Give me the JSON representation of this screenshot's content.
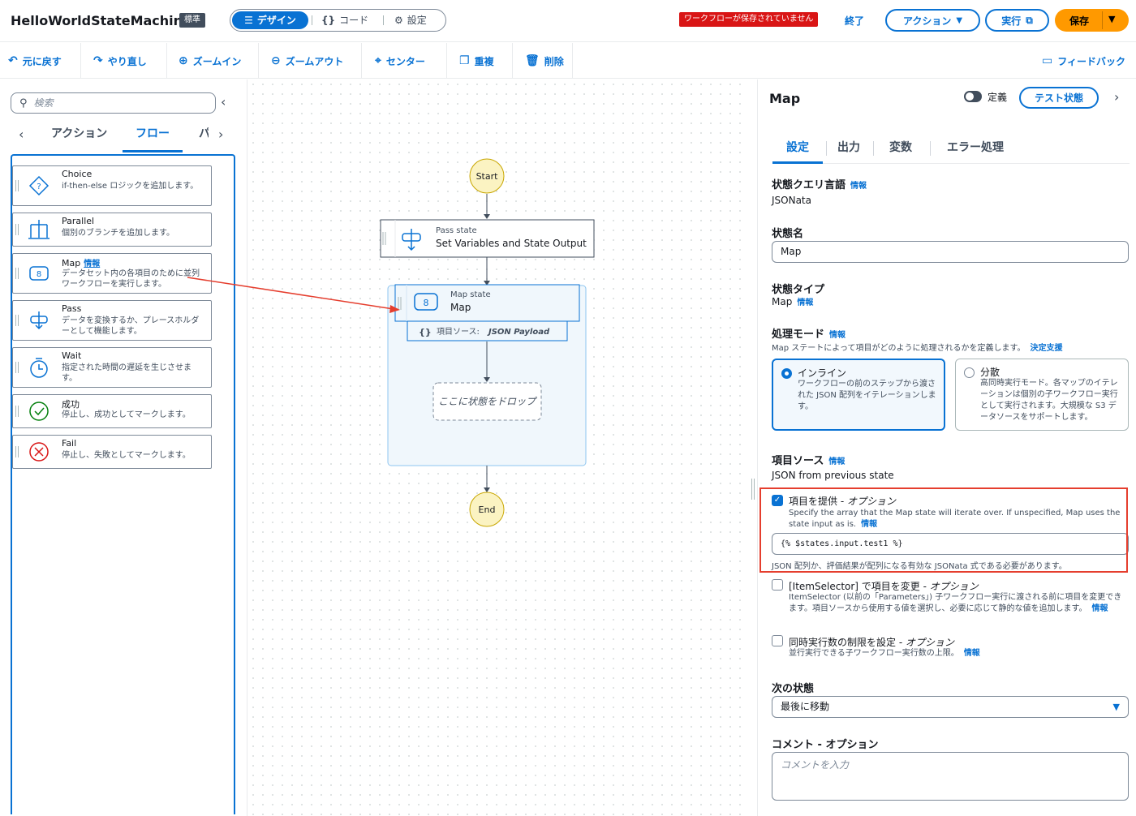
{
  "header": {
    "title": "HelloWorldStateMachine",
    "badge": "標準",
    "modes": {
      "design": "デザイン",
      "code": "コード",
      "settings": "設定"
    },
    "unsaved_notice": "ワークフローが保存されていません",
    "exit": "終了",
    "actions": "アクション",
    "run": "実行",
    "save": "保存"
  },
  "toolbar": {
    "undo": "元に戻す",
    "redo": "やり直し",
    "zoom_in": "ズームイン",
    "zoom_out": "ズームアウト",
    "center": "センター",
    "duplicate": "重複",
    "delete": "削除",
    "feedback": "フィードバック"
  },
  "left_panel": {
    "search_placeholder": "検索",
    "tabs": [
      "アクション",
      "フロー",
      "パ"
    ],
    "states": [
      {
        "name": "Choice",
        "desc": "if-then-else ロジックを追加します。",
        "icon": "choice-icon"
      },
      {
        "name": "Parallel",
        "desc": "個別のブランチを追加します。",
        "icon": "parallel-icon"
      },
      {
        "name": "Map",
        "info": "情報",
        "desc": "データセット内の各項目のために並列ワークフローを実行します。",
        "icon": "map-icon"
      },
      {
        "name": "Pass",
        "desc": "データを変換するか、プレースホルダーとして機能します。",
        "icon": "pass-icon"
      },
      {
        "name": "Wait",
        "desc": "指定された時間の遅延を生じさせます。",
        "icon": "wait-icon"
      },
      {
        "name": "成功",
        "desc": "停止し、成功としてマークします。",
        "icon": "success-icon"
      },
      {
        "name": "Fail",
        "desc": "停止し、失敗としてマークします。",
        "icon": "fail-icon"
      }
    ]
  },
  "canvas": {
    "start": "Start",
    "end": "End",
    "pass_type": "Pass state",
    "pass_name": "Set Variables and State Output",
    "map_type": "Map state",
    "map_name": "Map",
    "items_source_prefix": "項目ソース:",
    "items_source_value": "JSON Payload",
    "drop_here": "ここに状態をドロップ"
  },
  "right_panel": {
    "title": "Map",
    "definition": "定義",
    "test_state": "テスト状態",
    "tabs": [
      "設定",
      "出力",
      "変数",
      "エラー処理"
    ],
    "info": "情報",
    "query_language_label": "状態クエリ言語",
    "query_language_value": "JSONata",
    "state_name_label": "状態名",
    "state_name_value": "Map",
    "state_type_label": "状態タイプ",
    "state_type_value": "Map",
    "processing_mode_label": "処理モード",
    "processing_mode_desc": "Map ステートによって項目がどのように処理されるかを定義します。",
    "decision_support": "決定支援",
    "inline_title": "インライン",
    "inline_desc": "ワークフローの前のステップから渡された JSON 配列をイテレーションします。",
    "distributed_title": "分散",
    "distributed_desc": "高同時実行モード。各マップのイテレーションは個別の子ワークフロー実行として実行されます。大規模な S3 データソースをサポートします。",
    "items_source_label": "項目ソース",
    "items_source_value": "JSON from previous state",
    "provide_items_label": "項目を提供 - ",
    "provide_items_option": "オプション",
    "provide_items_desc": "Specify the array that the Map state will iterate over. If unspecified, Map uses the state input as is.",
    "provide_items_value": "{% $states.input.test1 %}",
    "provide_items_hint": "JSON 配列か、評価結果が配列になる有効な JSONata 式である必要があります。",
    "item_selector_label": "[ItemSelector] で項目を変更 - ",
    "item_selector_option": "オプション",
    "item_selector_desc": "ItemSelector (以前の「Parameters」) 子ワークフロー実行に渡される前に項目を変更できます。項目ソースから使用する値を選択し、必要に応じて静的な値を追加します。",
    "concurrency_label": "同時実行数の制限を設定 - ",
    "concurrency_option": "オプション",
    "concurrency_desc": "並行実行できる子ワークフロー実行数の上限。",
    "next_state_label": "次の状態",
    "next_state_value": "最後に移動",
    "comment_label": "コメント - オプション",
    "comment_placeholder": "コメントを入力"
  },
  "colors": {
    "accent": "#0972d3",
    "save": "#ff9900",
    "unsaved": "#d91515",
    "highlight": "#e53e2e",
    "node_fill": "#fbf3c2"
  }
}
